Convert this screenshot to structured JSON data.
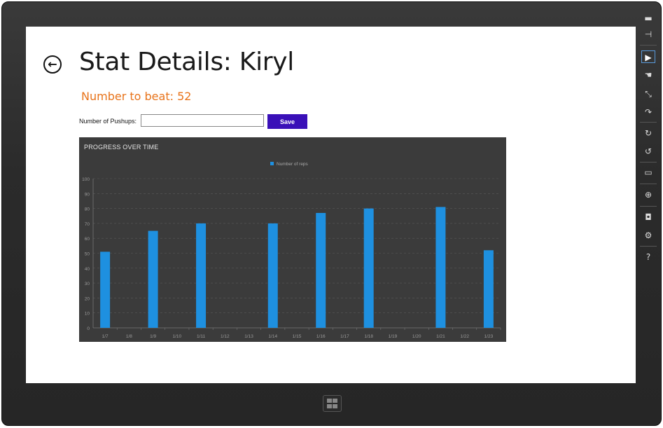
{
  "page": {
    "title": "Stat Details: Kiryl",
    "number_to_beat": "Number to beat: 52"
  },
  "form": {
    "label": "Number of Pushups:",
    "input_value": "",
    "input_placeholder": "",
    "save_label": "Save"
  },
  "chart_data": {
    "type": "bar",
    "title": "PROGRESS OVER TIME",
    "legend_position": "top-center",
    "grid": true,
    "xlabel": "",
    "ylabel": "",
    "ylim": [
      0,
      100
    ],
    "yticks": [
      0,
      10,
      20,
      30,
      40,
      50,
      60,
      70,
      80,
      90,
      100
    ],
    "categories": [
      "1/7",
      "1/8",
      "1/9",
      "1/10",
      "1/11",
      "1/12",
      "1/13",
      "1/14",
      "1/15",
      "1/16",
      "1/17",
      "1/18",
      "1/19",
      "1/20",
      "1/21",
      "1/22",
      "1/23"
    ],
    "series": [
      {
        "name": "Number of reps",
        "color": "#1e90e0",
        "values": [
          51,
          null,
          65,
          null,
          70,
          null,
          null,
          70,
          null,
          77,
          null,
          80,
          null,
          null,
          81,
          null,
          52
        ]
      }
    ],
    "background": "#3b3b3b"
  },
  "colors": {
    "accent_orange": "#e8731a",
    "save_button": "#3a10b8",
    "bar": "#1e90e0"
  },
  "charms": [
    {
      "icon": "minimize-icon",
      "glyph": "▬"
    },
    {
      "icon": "pin-icon",
      "glyph": "⊣"
    },
    {
      "icon": "pointer-icon",
      "glyph": "▶"
    },
    {
      "icon": "touch-icon",
      "glyph": "☚"
    },
    {
      "icon": "pinch-icon",
      "glyph": "⤡"
    },
    {
      "icon": "rotate-icon",
      "glyph": "↷"
    },
    {
      "icon": "rotate-clockwise-icon",
      "glyph": "↻"
    },
    {
      "icon": "rotate-counterclockwise-icon",
      "glyph": "↺"
    },
    {
      "icon": "monitor-icon",
      "glyph": "▭"
    },
    {
      "icon": "globe-icon",
      "glyph": "⊕"
    },
    {
      "icon": "camera-icon",
      "glyph": "◘"
    },
    {
      "icon": "settings-icon",
      "glyph": "⚙"
    },
    {
      "icon": "help-icon",
      "glyph": "?"
    }
  ]
}
